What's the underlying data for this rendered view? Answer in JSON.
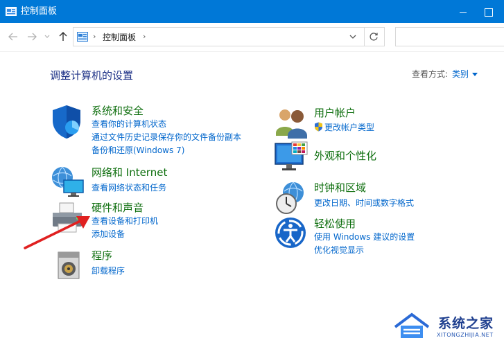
{
  "window": {
    "title": "控制面板"
  },
  "address_bar": {
    "breadcrumb": "控制面板",
    "separator": "›"
  },
  "main": {
    "title": "调整计算机的设置",
    "view_by_label": "查看方式:",
    "view_by_value": "类别"
  },
  "categories": {
    "system_security": {
      "heading": "系统和安全",
      "links": [
        "查看你的计算机状态",
        "通过文件历史记录保存你的文件备份副本",
        "备份和还原(Windows 7)"
      ]
    },
    "network": {
      "heading": "网络和 Internet",
      "links": [
        "查看网络状态和任务"
      ]
    },
    "hardware_sound": {
      "heading": "硬件和声音",
      "links": [
        "查看设备和打印机",
        "添加设备"
      ]
    },
    "programs": {
      "heading": "程序",
      "links": [
        "卸载程序"
      ]
    },
    "user_accounts": {
      "heading": "用户帐户",
      "links": [
        "更改帐户类型"
      ]
    },
    "appearance": {
      "heading": "外观和个性化",
      "links": []
    },
    "clock_region": {
      "heading": "时钟和区域",
      "links": [
        "更改日期、时间或数字格式"
      ]
    },
    "ease_of_access": {
      "heading": "轻松使用",
      "links": [
        "使用 Windows 建议的设置",
        "优化视觉显示"
      ]
    }
  },
  "watermark": {
    "name": "系统之家",
    "url": "XITONGZHIJIA.NET"
  },
  "colors": {
    "titlebar": "#0078d7",
    "heading": "#0d6e0d",
    "link": "#0066cc",
    "page_title": "#1e3287",
    "arrow": "#e02020"
  }
}
